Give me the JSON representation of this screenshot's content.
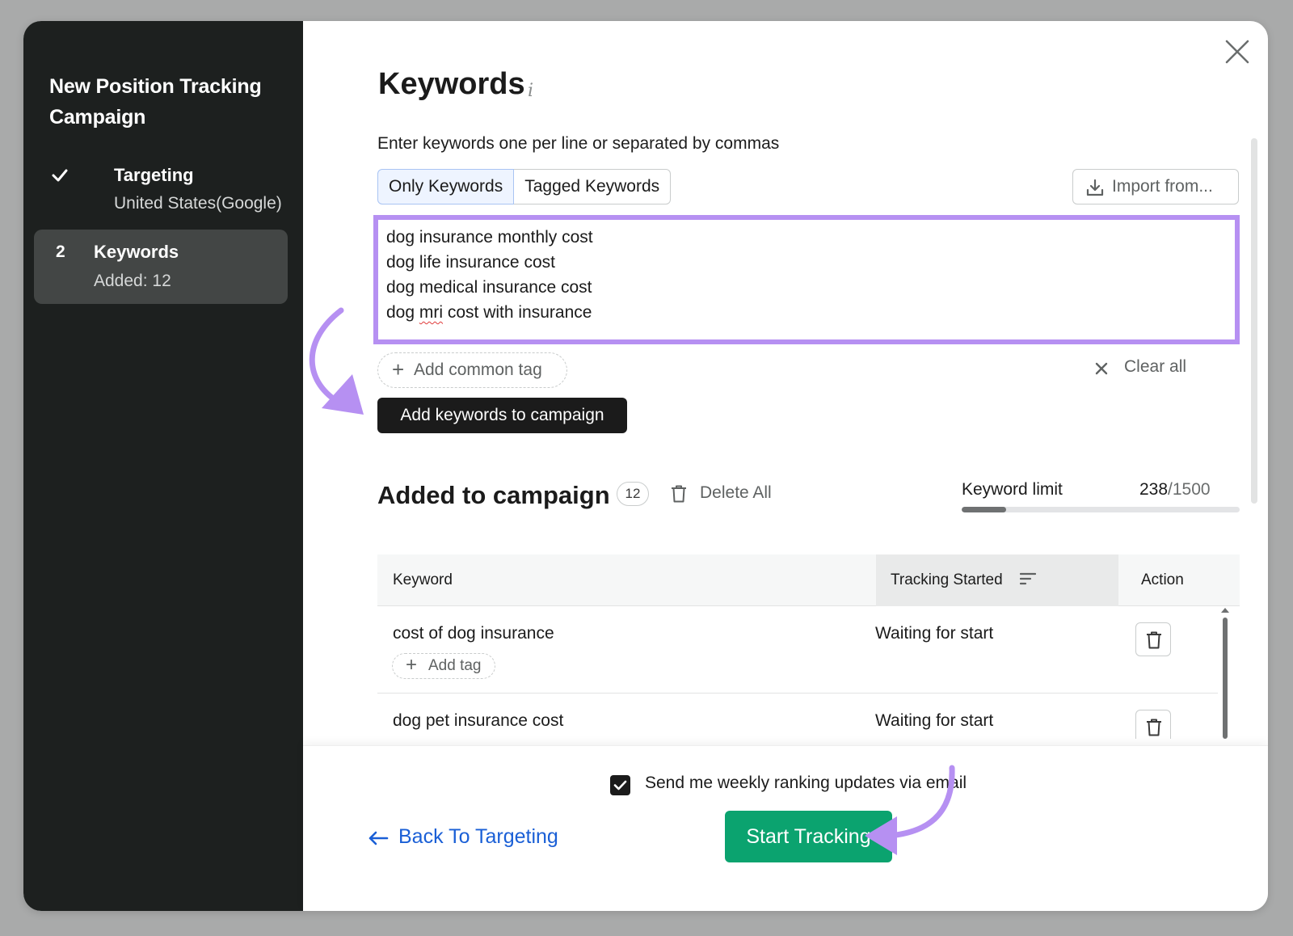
{
  "sidebar": {
    "title": "New Position Tracking Campaign",
    "steps": [
      {
        "label": "Targeting",
        "sub": "United States(Google)",
        "state": "done",
        "icon": "check-icon"
      },
      {
        "number": "2",
        "label": "Keywords",
        "sub": "Added: 12",
        "state": "active"
      }
    ]
  },
  "main": {
    "title": "Keywords",
    "info_glyph": "i",
    "instruction": "Enter keywords one per line or separated by commas",
    "tabs": [
      {
        "label": "Only Keywords",
        "active": true
      },
      {
        "label": "Tagged Keywords",
        "active": false
      }
    ],
    "import_label": "Import from...",
    "keywords_input": {
      "lines": [
        "dog insurance monthly cost",
        "dog life insurance cost",
        "dog medical insurance cost"
      ],
      "line4_before": "dog ",
      "line4_misspelled": "mri",
      "line4_after": " cost with insurance"
    },
    "add_common_tag_label": "Add common tag",
    "clear_all_label": "Clear all",
    "add_keywords_label": "Add keywords to campaign"
  },
  "added": {
    "title": "Added to campaign",
    "count": "12",
    "delete_all_label": "Delete All",
    "limit_label": "Keyword limit",
    "limit_used": "238",
    "limit_total": "/1500",
    "limit_fraction": 0.1587
  },
  "table": {
    "columns": [
      "Keyword",
      "Tracking Started",
      "Action"
    ],
    "rows": [
      {
        "keyword": "cost of dog insurance",
        "status": "Waiting for start",
        "add_tag_label": "Add tag"
      },
      {
        "keyword": "dog pet insurance cost",
        "status": "Waiting for start"
      }
    ]
  },
  "footer": {
    "email_checkbox_checked": true,
    "email_label": "Send me weekly ranking updates via email",
    "back_label": "Back To Targeting",
    "start_label": "Start Tracking"
  },
  "colors": {
    "accent_purple": "#b690f2",
    "start_green": "#0ba36f",
    "link_blue": "#1a5fd6",
    "sidebar_bg": "#1d201f"
  }
}
